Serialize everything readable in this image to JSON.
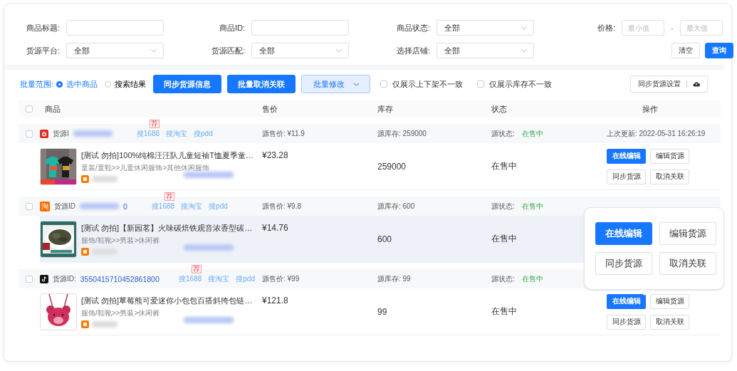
{
  "filters": [
    {
      "label": "商品标题:",
      "kind": "input"
    },
    {
      "label": "商品ID:",
      "kind": "input"
    },
    {
      "label": "商品状态:",
      "kind": "select",
      "value": "全部"
    },
    {
      "label": "价格:",
      "kind": "range",
      "min_placeholder": "最小值",
      "separator": "-",
      "max_placeholder": "最大值"
    },
    {
      "label": "货源平台:",
      "kind": "select",
      "value": "全部"
    },
    {
      "label": "货源匹配:",
      "kind": "select",
      "value": "全部"
    },
    {
      "label": "选择店铺:",
      "kind": "select",
      "value": "全部"
    }
  ],
  "filter_buttons": [
    {
      "label": "清空",
      "primary": false
    },
    {
      "label": "查询",
      "primary": true
    }
  ],
  "toolbar": {
    "scope_label": "批量范围:",
    "scope_options": [
      {
        "label": "选中商品",
        "selected": true
      },
      {
        "label": "搜索结果",
        "selected": false
      }
    ],
    "actions": [
      {
        "label": "同步货源信息",
        "kind": "primary"
      },
      {
        "label": "批量取消关联",
        "kind": "primary"
      },
      {
        "label": "批量修改",
        "kind": "dropdown"
      }
    ],
    "toggles": [
      {
        "label": "仅展示上下架不一致",
        "checked": false
      },
      {
        "label": "仅展示库存不一致",
        "checked": false
      }
    ],
    "settings_button": "同步货源设置"
  },
  "table": {
    "checked": false,
    "columns": [
      "商品",
      "售价",
      "库存",
      "状态",
      "操作"
    ],
    "groups": [
      {
        "checked": false,
        "kind": "red",
        "source_label": "货源I",
        "source_id_blurred": true,
        "badge": "荐",
        "search_links": [
          "搜1688",
          "搜淘宝",
          "搜pdd"
        ],
        "source_price": "源售价: ¥11.9",
        "source_stock": "源库存: 259000",
        "source_status_label": "源状态:",
        "source_status": "在售中",
        "updated": "上次更新: 2022-05-31 16:26:19",
        "product": {
          "kind": "tshirt",
          "highlighted": false,
          "title": "[测试 勿拍]100%纯棉汪汪队儿童短袖T恤夏季童…",
          "category": "童装/童鞋>>儿童休闲服饰>其他休闲服饰",
          "price": "¥23.28",
          "stock": "259000",
          "status": "在售中",
          "actions": [
            {
              "label": "在线编辑",
              "primary": true
            },
            {
              "label": "编辑货源",
              "primary": false
            },
            {
              "label": "同步货源",
              "primary": false
            },
            {
              "label": "取消关联",
              "primary": false
            }
          ]
        }
      },
      {
        "checked": false,
        "kind": "orange",
        "platform_glyph": "淘",
        "source_label": "货源ID",
        "source_id_blurred": true,
        "source_id_tail": "0",
        "badge": "荐",
        "search_links": [
          "搜1688",
          "搜淘宝",
          "搜pdd"
        ],
        "source_price": "源售价: ¥9.8",
        "source_stock": "源库存: 600",
        "source_status_label": "源状态:",
        "source_status": "在售中",
        "product": {
          "kind": "tea",
          "highlighted": true,
          "title": "[测试 勿拍]【新园茗】火味碳焙铁观音浓香型碳…",
          "category": "服饰/鞋靴>>男装>休闲裤",
          "price": "¥14.76",
          "stock": "600",
          "status": "在售中"
        }
      },
      {
        "checked": false,
        "kind": "black",
        "source_label": "货源ID:",
        "source_id": "3550415710452861800",
        "badge": "荐",
        "search_links": [
          "搜1688",
          "搜淘宝",
          "搜pdd"
        ],
        "source_price": "源售价: ¥99",
        "source_stock": "源库存: 99",
        "source_status_label": "源状态:",
        "source_status": "在售中",
        "product": {
          "kind": "bear",
          "highlighted": false,
          "title": "[测试 勿拍]草莓熊可爱迷你小包包百搭斜挎包链…",
          "category": "服饰/鞋靴>>男装>休闲裤",
          "price": "¥121.8",
          "stock": "99",
          "status": "在售中",
          "actions": [
            {
              "label": "在线编辑",
              "primary": true
            },
            {
              "label": "编辑货源",
              "primary": false
            },
            {
              "label": "同步货源",
              "primary": false
            },
            {
              "label": "取消关联",
              "primary": false
            }
          ]
        }
      }
    ]
  },
  "popover": {
    "actions": [
      {
        "label": "在线编辑",
        "primary": true
      },
      {
        "label": "编辑货源",
        "primary": false
      },
      {
        "label": "同步货源",
        "primary": false
      },
      {
        "label": "取消关联",
        "primary": false
      }
    ]
  }
}
